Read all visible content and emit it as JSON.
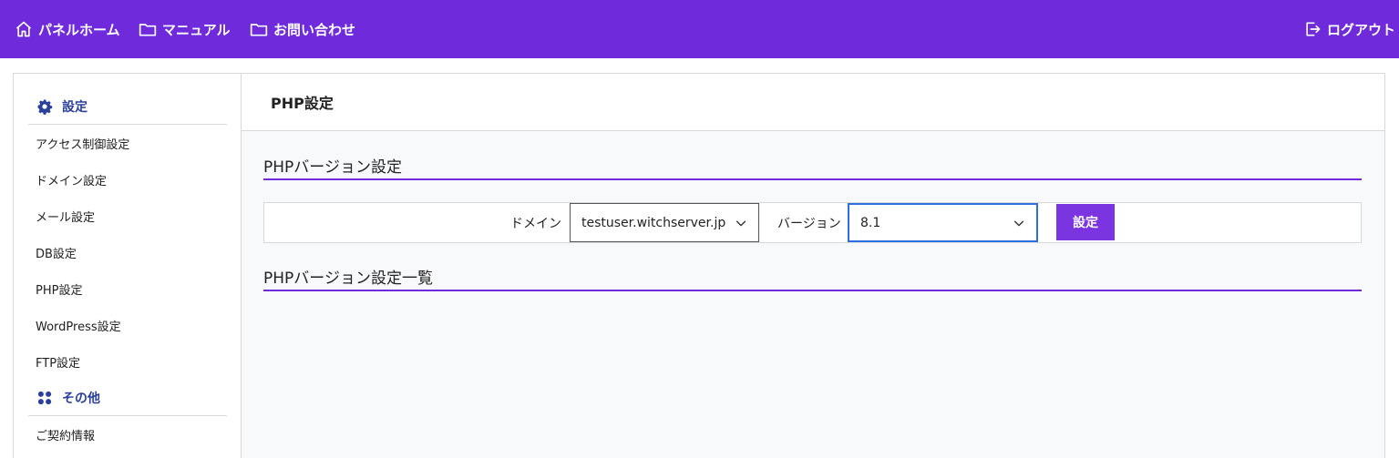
{
  "colors": {
    "nav_bg": "#6f2adb",
    "accent_blue": "#2a3f9d",
    "button_bg": "#7b35e0",
    "section_underline": "#6f2adb",
    "focus_border": "#2d6fe0"
  },
  "nav": {
    "home": {
      "label": "パネルホーム",
      "icon": "home-icon"
    },
    "manual": {
      "label": "マニュアル",
      "icon": "folder-icon"
    },
    "contact": {
      "label": "お問い合わせ",
      "icon": "folder-icon"
    },
    "logout": {
      "label": "ログアウト",
      "icon": "logout-icon"
    }
  },
  "sidebar": {
    "settings_header": {
      "label": "設定",
      "icon": "gear-icon"
    },
    "items": [
      {
        "label": "アクセス制御設定"
      },
      {
        "label": "ドメイン設定"
      },
      {
        "label": "メール設定"
      },
      {
        "label": "DB設定"
      },
      {
        "label": "PHP設定"
      },
      {
        "label": "WordPress設定"
      },
      {
        "label": "FTP設定"
      }
    ],
    "other_header": {
      "label": "その他",
      "icon": "grid-icon"
    },
    "other_items": [
      {
        "label": "ご契約情報"
      }
    ]
  },
  "main": {
    "page_title": "PHP設定",
    "section1_title": "PHPバージョン設定",
    "form": {
      "domain_label": "ドメイン",
      "domain_value": "testuser.witchserver.jp",
      "version_label": "バージョン",
      "version_value": "8.1",
      "submit_label": "設定"
    },
    "section2_title": "PHPバージョン設定一覧"
  }
}
